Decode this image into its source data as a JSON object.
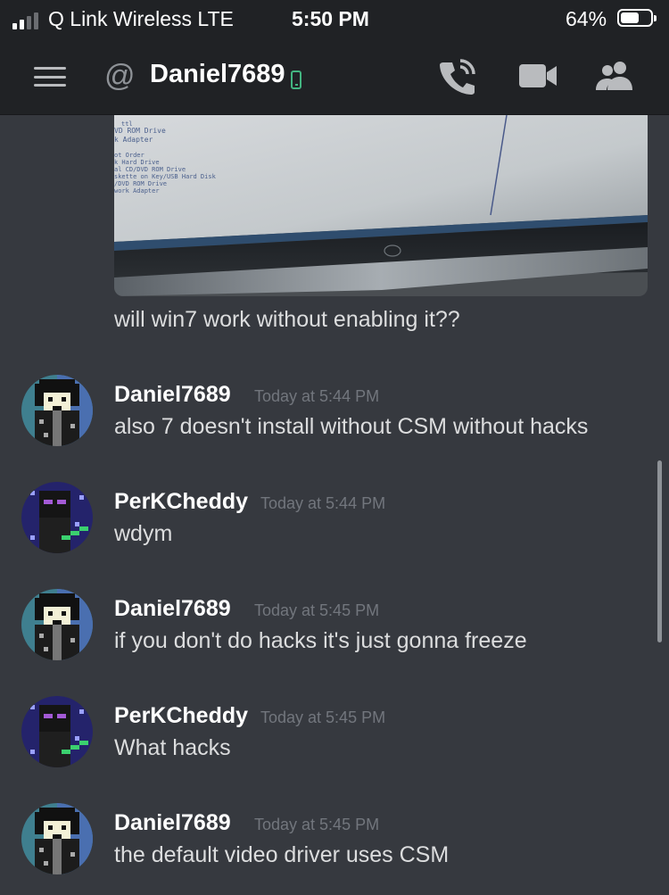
{
  "status_bar": {
    "carrier": "Q Link Wireless  LTE",
    "time": "5:50 PM",
    "battery": "64%",
    "battery_level": 0.64,
    "signal_bars": 2
  },
  "header": {
    "channel": "Daniel7689",
    "status": "mobile-online",
    "status_color": "#43b581"
  },
  "colors": {
    "background": "#36393f",
    "header": "#202225",
    "timestamp": "#72767d"
  },
  "first_message_text": "will win7 work without enabling it??",
  "messages": [
    {
      "author": "Daniel7689",
      "time": "Today at 5:44 PM",
      "text": "also 7 doesn't install without CSM without hacks"
    },
    {
      "author": "PerKCheddy",
      "time": "Today at 5:44 PM",
      "text": "wdym"
    },
    {
      "author": "Daniel7689",
      "time": "Today at 5:45 PM",
      "text": "if you don't do hacks it's just gonna freeze"
    },
    {
      "author": "PerKCheddy",
      "time": "Today at 5:45 PM",
      "text": "What hacks"
    },
    {
      "author": "Daniel7689",
      "time": "Today at 5:45 PM",
      "text": "the default video driver uses CSM"
    }
  ],
  "bios_photo_text": [
    "ttl",
    "VD ROM Drive",
    "k Adapter",
    "ot Order",
    "k Hard Drive",
    "al CD/DVD ROM Drive",
    "skette on Key/USB Hard Disk",
    "/DVD ROM Drive",
    "work Adapter"
  ]
}
